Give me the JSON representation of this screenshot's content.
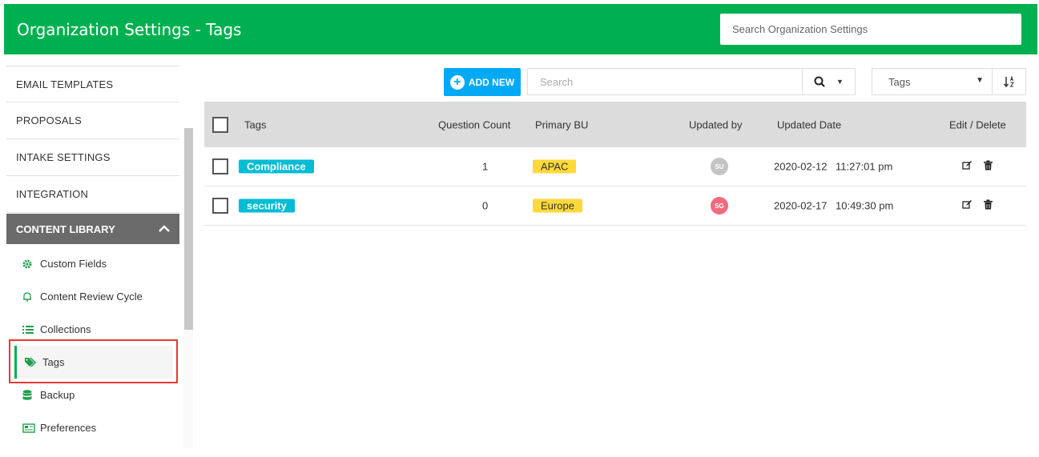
{
  "header": {
    "title": "Organization Settings - Tags",
    "search_placeholder": "Search Organization Settings"
  },
  "sidebar": {
    "items": [
      {
        "label": "EMAIL TEMPLATES"
      },
      {
        "label": "PROPOSALS"
      },
      {
        "label": "INTAKE SETTINGS"
      },
      {
        "label": "INTEGRATION"
      }
    ],
    "section": {
      "label": "CONTENT LIBRARY"
    },
    "sub_items": [
      {
        "label": "Custom Fields",
        "icon": "gear-icon"
      },
      {
        "label": "Content Review Cycle",
        "icon": "bell-icon"
      },
      {
        "label": "Collections",
        "icon": "list-icon"
      },
      {
        "label": "Tags",
        "icon": "tags-icon"
      },
      {
        "label": "Backup",
        "icon": "database-icon"
      },
      {
        "label": "Preferences",
        "icon": "newspaper-icon"
      }
    ]
  },
  "toolbar": {
    "add_label": "ADD NEW",
    "search_placeholder": "Search",
    "filter_value": "Tags"
  },
  "table": {
    "columns": [
      "Tags",
      "Question Count",
      "Primary BU",
      "Updated by",
      "Updated Date",
      "Edit / Delete"
    ],
    "rows": [
      {
        "tag": "Compliance",
        "count": "1",
        "bu": "APAC",
        "updated_by": "SU",
        "avatar_color": "#c4c4c4",
        "date": "2020-02-12",
        "time": "11:27:01 pm"
      },
      {
        "tag": "security",
        "count": "0",
        "bu": "Europe",
        "updated_by": "SG",
        "avatar_color": "#f06b7e",
        "date": "2020-02-17",
        "time": "10:49:30 pm"
      }
    ]
  },
  "colors": {
    "brand": "#00b050",
    "accent": "#03a9f4",
    "tag": "#00bcd4",
    "bu": "#ffd93b"
  }
}
